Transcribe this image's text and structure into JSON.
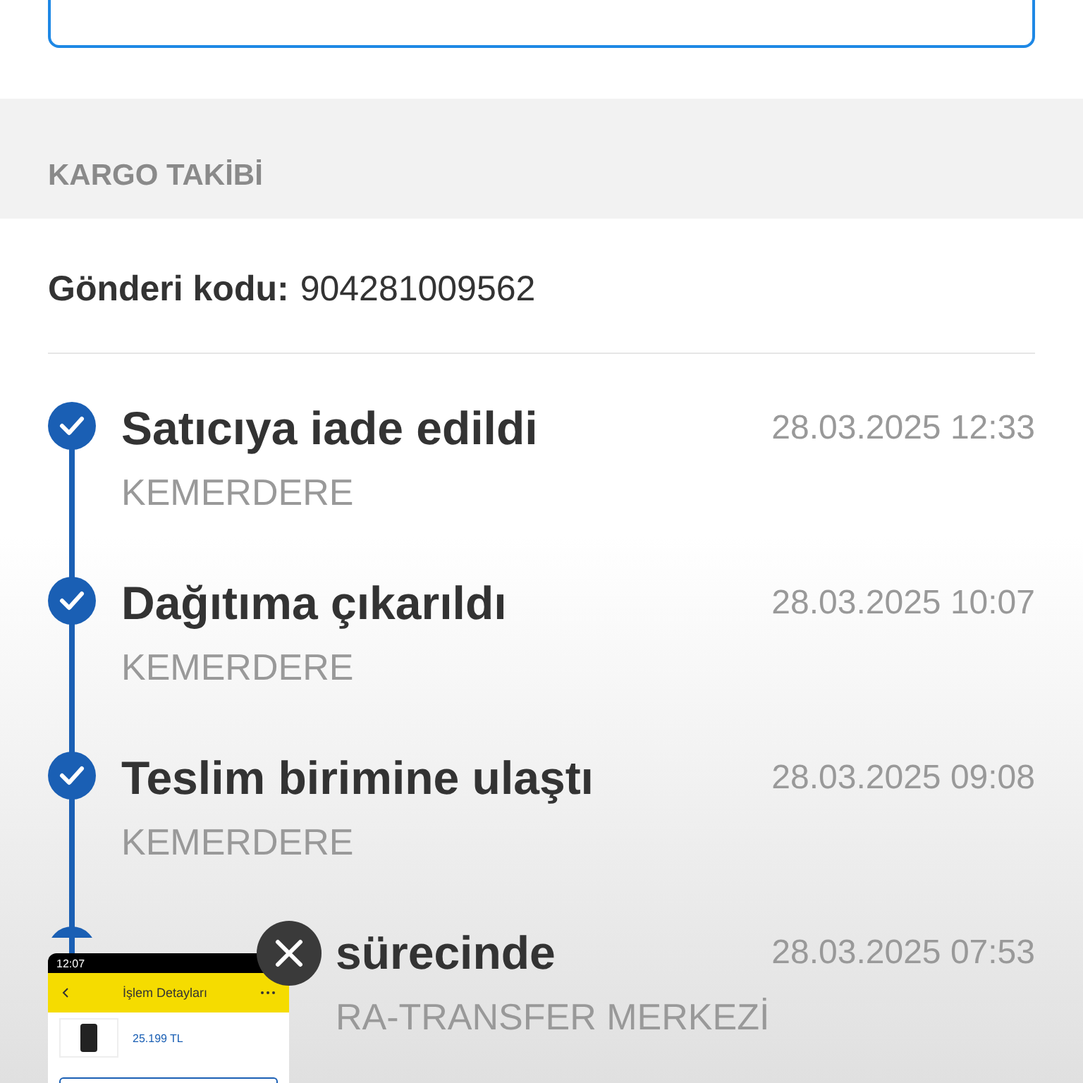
{
  "section_title": "KARGO TAKİBİ",
  "shipment": {
    "label": "Gönderi kodu:",
    "code": "904281009562"
  },
  "events": [
    {
      "title": "Satıcıya iade edildi",
      "location": "KEMERDERE",
      "date": "28.03.2025 12:33",
      "done": true,
      "covered": false
    },
    {
      "title": "Dağıtıma çıkarıldı",
      "location": "KEMERDERE",
      "date": "28.03.2025 10:07",
      "done": true,
      "covered": false
    },
    {
      "title": "Teslim birimine ulaştı",
      "location": "KEMERDERE",
      "date": "28.03.2025 09:08",
      "done": true,
      "covered": false
    },
    {
      "title": "sürecinde",
      "location": "RA-TRANSFER MERKEZİ",
      "date": "28.03.2025 07:53",
      "done": true,
      "covered": true
    }
  ],
  "screenshot_preview": {
    "time": "12:07",
    "title": "İşlem Detayları",
    "price": "25.199 TL"
  }
}
